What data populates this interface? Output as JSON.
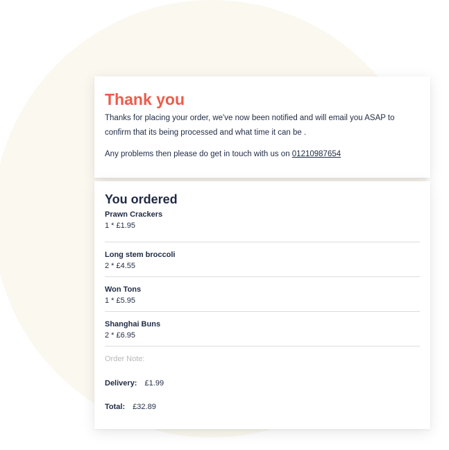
{
  "confirmation": {
    "title": "Thank you",
    "message": "Thanks for placing your order, we've now been notified and will email you ASAP to confirm that its being processed and what time it can be .",
    "contact_prefix": "Any problems then please do get in touch with us on ",
    "phone": "01210987654"
  },
  "order": {
    "title": "You ordered",
    "items": [
      {
        "name": "Prawn Crackers",
        "quantity": "1 * £1.95"
      },
      {
        "name": "Long stem broccoli",
        "quantity": "2 * £4.55"
      },
      {
        "name": "Won Tons",
        "quantity": "1 * £5.95"
      },
      {
        "name": "Shanghai Buns",
        "quantity": "2 * £6.95"
      }
    ],
    "note_label": "Order Note:",
    "delivery_label": "Delivery:",
    "delivery_value": "£1.99",
    "total_label": "Total:",
    "total_value": "£32.89"
  },
  "colors": {
    "accent": "#ef5b49",
    "text": "#1f2a44",
    "muted": "#b8b8b8",
    "background_circle": "#fbf8f0"
  }
}
